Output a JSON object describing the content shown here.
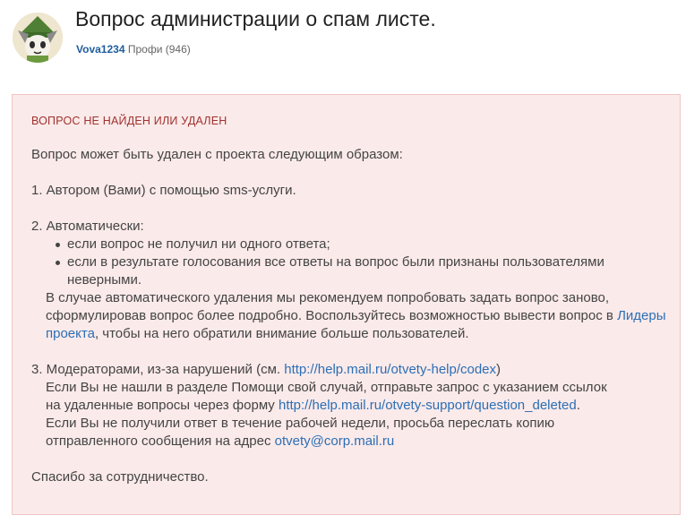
{
  "question": {
    "title": "Вопрос администрации о спам листе.",
    "author": "Vova1234",
    "rank": "Профи (946)"
  },
  "notice": {
    "heading": "ВОПРОС НЕ НАЙДЕН ИЛИ УДАЛЕН",
    "intro": "Вопрос может быть удален с проекта следующим образом:",
    "p1": "1. Автором (Вами) с помощью sms-услуги.",
    "p2_title": "2. Автоматически:",
    "bullet1": "если вопрос не получил ни одного ответа;",
    "bullet2_a": "если в результате голосования все ответы на вопрос были признаны пользователями",
    "bullet2_b": "неверными.",
    "auto_a": "В случае автоматического удаления мы рекомендуем попробовать задать вопрос заново,",
    "auto_b": "сформулировав вопрос более подробно. Воспользуйтесь возможностью вывести вопрос в ",
    "leaders_link_a": "Лидеры",
    "leaders_link_b": "проекта",
    "auto_c": ", чтобы на него обратили внимание больше пользователей.",
    "p3_title": "3. Модераторами, из-за нарушений (см. ",
    "codex_link": "http://help.mail.ru/otvety-help/codex",
    "p3_close": ")",
    "mod_a": "Если Вы не нашли в разделе Помощи свой случай, отправьте запрос с указанием ссылок",
    "mod_b": "на удаленные вопросы через форму ",
    "support_link": "http://help.mail.ru/otvety-support/question_deleted",
    "mod_b_end": ".",
    "mod_c": "Если Вы не получили ответ в течение рабочей недели, просьба переслать копию",
    "mod_d": "отправленного сообщения на адрес ",
    "email_link": "otvety@corp.mail.ru",
    "thanks": "Спасибо за сотрудничество."
  }
}
